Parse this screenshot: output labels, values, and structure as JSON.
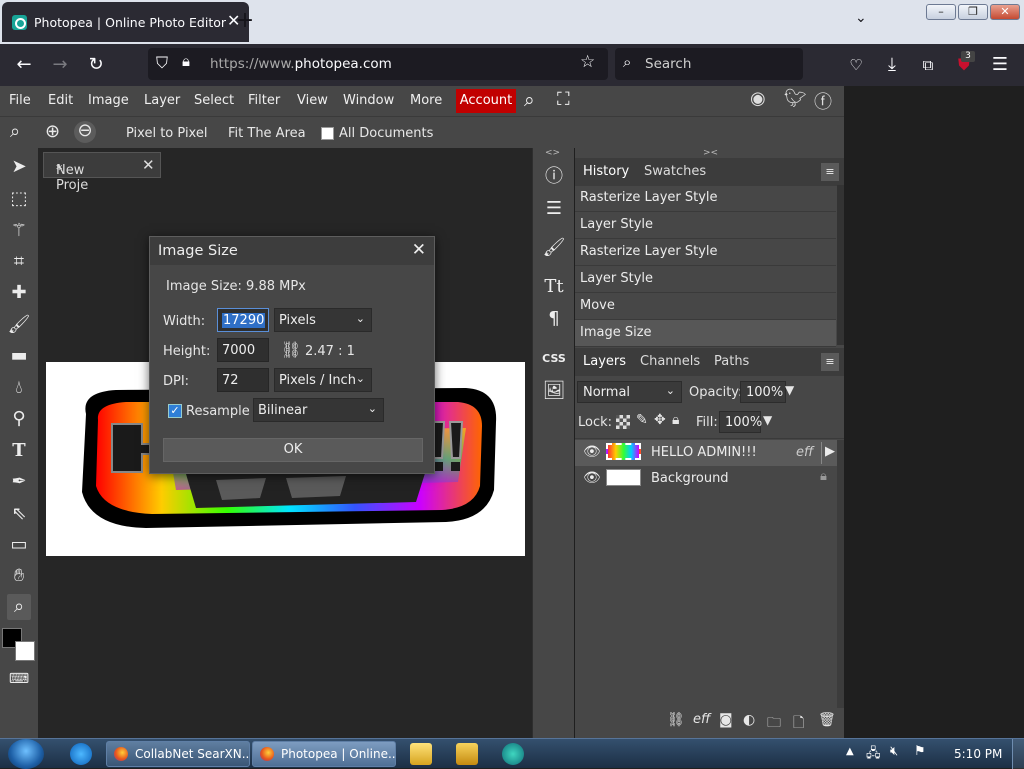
{
  "browser": {
    "tab_title": "Photopea | Online Photo Editor",
    "tab_close": "✕",
    "new_tab": "+",
    "url_prefix": "https://www.",
    "url_domain": "photopea.com",
    "search_placeholder": "Search",
    "extension_badge": "3"
  },
  "menu": {
    "items": [
      "File",
      "Edit",
      "Image",
      "Layer",
      "Select",
      "Filter",
      "View",
      "Window",
      "More"
    ],
    "account": "Account"
  },
  "options_bar": {
    "pixel_to_pixel": "Pixel to Pixel",
    "fit_area": "Fit The Area",
    "all_documents": "All Documents"
  },
  "document_tab": {
    "name": "New Proje",
    "dirty_mark": "*",
    "close": "✕"
  },
  "history_panel": {
    "tabs": [
      "History",
      "Swatches"
    ],
    "items": [
      "Rasterize Layer Style",
      "Layer Style",
      "Rasterize Layer Style",
      "Layer Style",
      "Move",
      "Image Size"
    ]
  },
  "layers_panel": {
    "tabs": [
      "Layers",
      "Channels",
      "Paths"
    ],
    "blend_mode": "Normal",
    "opacity_label": "Opacity:",
    "opacity_value": "100%",
    "lock_label": "Lock:",
    "fill_label": "Fill:",
    "fill_value": "100%",
    "layers": [
      {
        "name": "HELLO ADMIN!!!",
        "effects": "eff"
      },
      {
        "name": "Background"
      }
    ],
    "footer_fx": "eff"
  },
  "dialog": {
    "title": "Image Size",
    "close": "✕",
    "image_size": "Image Size: 9.88 MPx",
    "width_label": "Width:",
    "width_value": "17290",
    "width_unit": "Pixels",
    "height_label": "Height:",
    "height_value": "7000",
    "ratio": "2.47 : 1",
    "dpi_label": "DPI:",
    "dpi_value": "72",
    "dpi_unit": "Pixels / Inch",
    "resample_label": "Resample",
    "resample_method": "Bilinear",
    "ok": "OK"
  },
  "taskbar": {
    "buttons": [
      "CollabNet SearXN...",
      "Photopea | Online..."
    ],
    "clock": "5:10 PM"
  },
  "colors": {
    "accent_red": "#c10000",
    "panel_bg": "#474747",
    "canvas_bg": "#262626",
    "selection_blue": "#2f6fc6"
  }
}
